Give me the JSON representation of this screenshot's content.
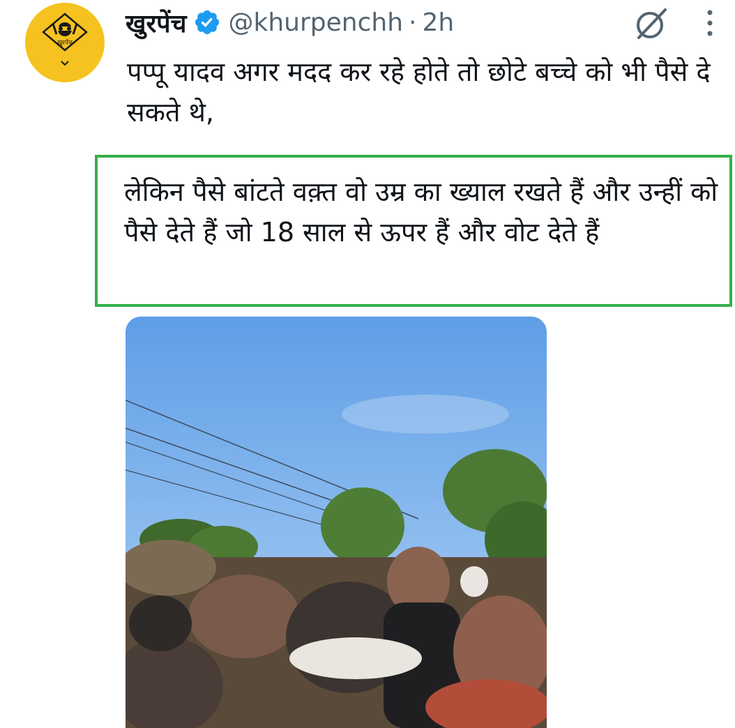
{
  "tweet": {
    "display_name": "खुरपेंच",
    "handle": "@khurpenchh",
    "separator": "·",
    "time": "2h",
    "text": "पप्पू यादव अगर मदद कर रहे होते तो छोटे बच्चे को भी पैसे दे सकते थे,",
    "highlighted_text": "लेकिन पैसे बांटते वक़्त वो उम्र का ख्याल रखते हैं और उन्हीं को पैसे देते हैं जो 18 साल से ऊपर हैं और वोट देते हैं",
    "avatar_logo_text": "खुरपेंच"
  },
  "icons": {
    "verified": "verified-badge-icon",
    "grok": "grok-icon",
    "more": "more-vertical-icon",
    "avatar_chevron": "chevron-down-icon"
  },
  "colors": {
    "verified_blue": "#1d9bf0",
    "highlight_border": "#34b04a",
    "avatar_background": "#f5c21f",
    "secondary_text": "#536471"
  }
}
